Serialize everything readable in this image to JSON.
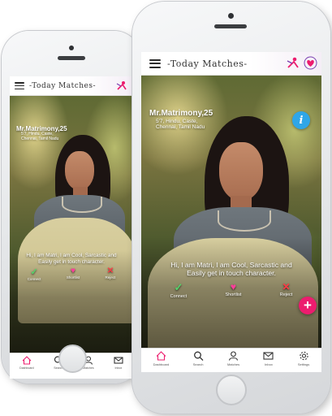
{
  "header": {
    "title": "-Today Matches-"
  },
  "profile": {
    "name": "Mr.Matrimony,25",
    "details": "5'7, Hindu, Caste,",
    "location": "Chennai, Tamil Nadu"
  },
  "bio_line1": "Hi, I am Matri, I am Cool, Sarcastic and",
  "bio_line2": "Easily get in touch character.",
  "actions": [
    {
      "label": "Connect",
      "icon": "check-icon"
    },
    {
      "label": "Shortlist",
      "icon": "heart-icon"
    },
    {
      "label": "Reject",
      "icon": "x-icon"
    }
  ],
  "info_label": "i",
  "add_label": "+",
  "nav_front": [
    {
      "label": "Dashboard",
      "icon": "home-icon"
    },
    {
      "label": "Search",
      "icon": "search-icon"
    },
    {
      "label": "Matches",
      "icon": "matches-icon"
    },
    {
      "label": "Inbox",
      "icon": "mail-icon"
    },
    {
      "label": "Settings",
      "icon": "gear-icon"
    }
  ],
  "nav_back": [
    {
      "label": "Dashboard",
      "icon": "home-icon"
    },
    {
      "label": "Search",
      "icon": "search-icon"
    },
    {
      "label": "Matches",
      "icon": "matches-icon"
    },
    {
      "label": "Inbox",
      "icon": "mail-icon"
    }
  ],
  "colors": {
    "accent": "#ec1c6e",
    "info": "#2fa6e8",
    "connect": "#55d46a",
    "reject": "#ff3b45"
  }
}
